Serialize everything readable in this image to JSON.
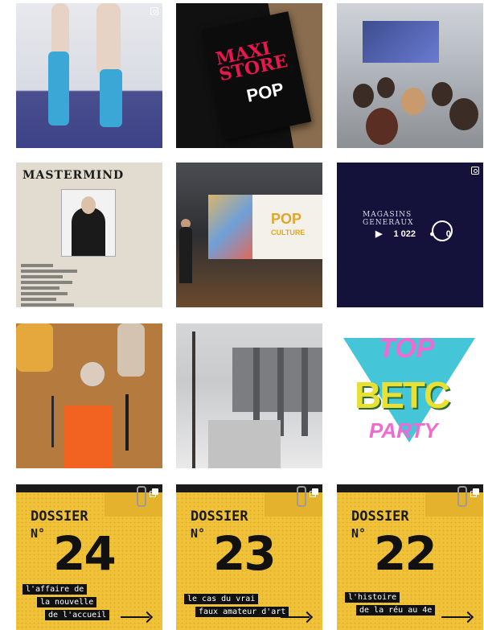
{
  "posts": [
    {
      "id": "socks"
    },
    {
      "id": "poster-pop",
      "poster_title": "MAXI STORE",
      "poster_word": "POP"
    },
    {
      "id": "conference"
    },
    {
      "id": "mastermind",
      "title": "MASTERMIND"
    },
    {
      "id": "pop-culture-talk",
      "screen_title": "POP",
      "screen_sub": "CULTURE"
    },
    {
      "id": "video",
      "brand_line1": "MAGASINS",
      "brand_line2": "GENERAUX",
      "views": "1 022",
      "comments": "0"
    },
    {
      "id": "table-setting"
    },
    {
      "id": "snowy-terrace"
    },
    {
      "id": "top-betc-party",
      "top": "TOP",
      "betc": "BETC",
      "party": "PARTY"
    },
    {
      "id": "dossier-24",
      "dossier": "DOSSIER",
      "no": "N°",
      "number": "24",
      "caption1": "l'affaire de",
      "caption2": "la nouvelle",
      "caption3": "de l'accueil"
    },
    {
      "id": "dossier-23",
      "dossier": "DOSSIER",
      "no": "N°",
      "number": "23",
      "caption1": "le cas du vrai",
      "caption2": "faux amateur d'art"
    },
    {
      "id": "dossier-22",
      "dossier": "DOSSIER",
      "no": "N°",
      "number": "22",
      "caption1": "l'histoire",
      "caption2": "de la réu au 4e"
    }
  ],
  "icons": {
    "corner": "camera-icon",
    "multi": "carousel-icon",
    "play": "play-icon"
  }
}
